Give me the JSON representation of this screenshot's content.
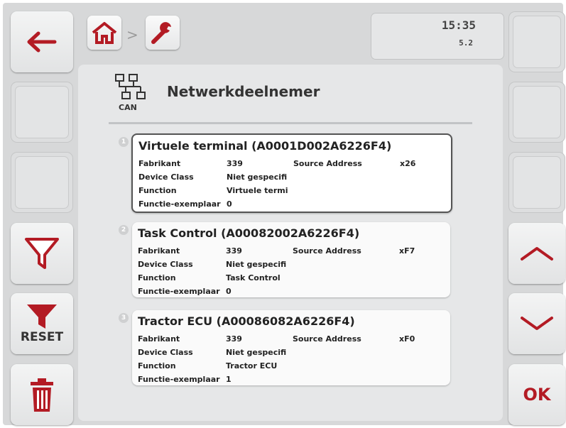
{
  "header": {
    "time": "15:35",
    "version": "5.2",
    "breadcrumb_separator": ">",
    "home_icon": "home-icon",
    "settings_icon": "wrench-icon"
  },
  "page": {
    "title": "Netwerkdeelnemer",
    "title_icon": "can-network-icon",
    "title_icon_label": "CAN"
  },
  "labels": {
    "manufacturer": "Fabrikant",
    "device_class": "Device Class",
    "function": "Function",
    "function_instance": "Functie-exemplaar",
    "source_address": "Source Address"
  },
  "devices": [
    {
      "index": "1",
      "name": "Virtuele terminal (A0001D002A6226F4)",
      "manufacturer": "339",
      "device_class": "Niet gespecifi",
      "function": "Virtuele termi",
      "function_instance": "0",
      "source_address": "x26",
      "selected": true
    },
    {
      "index": "2",
      "name": "Task Control (A00082002A6226F4)",
      "manufacturer": "339",
      "device_class": "Niet gespecifi",
      "function": "Task Control",
      "function_instance": "0",
      "source_address": "xF7",
      "selected": false
    },
    {
      "index": "3",
      "name": "Tractor ECU (A00086082A6226F4)",
      "manufacturer": "339",
      "device_class": "Niet gespecifi",
      "function": "Tractor ECU",
      "function_instance": "1",
      "source_address": "xF0",
      "selected": false
    }
  ],
  "softkeys_left": {
    "back_icon": "arrow-left-icon",
    "filter_icon": "filter-icon",
    "reset_label": "RESET",
    "delete_icon": "trash-icon"
  },
  "softkeys_right": {
    "up_icon": "chevron-up-icon",
    "down_icon": "chevron-down-icon",
    "ok_label": "OK"
  },
  "colors": {
    "accent_red": "#b31b24",
    "background": "#d7d8d9",
    "panel": "#e6e7e8"
  }
}
